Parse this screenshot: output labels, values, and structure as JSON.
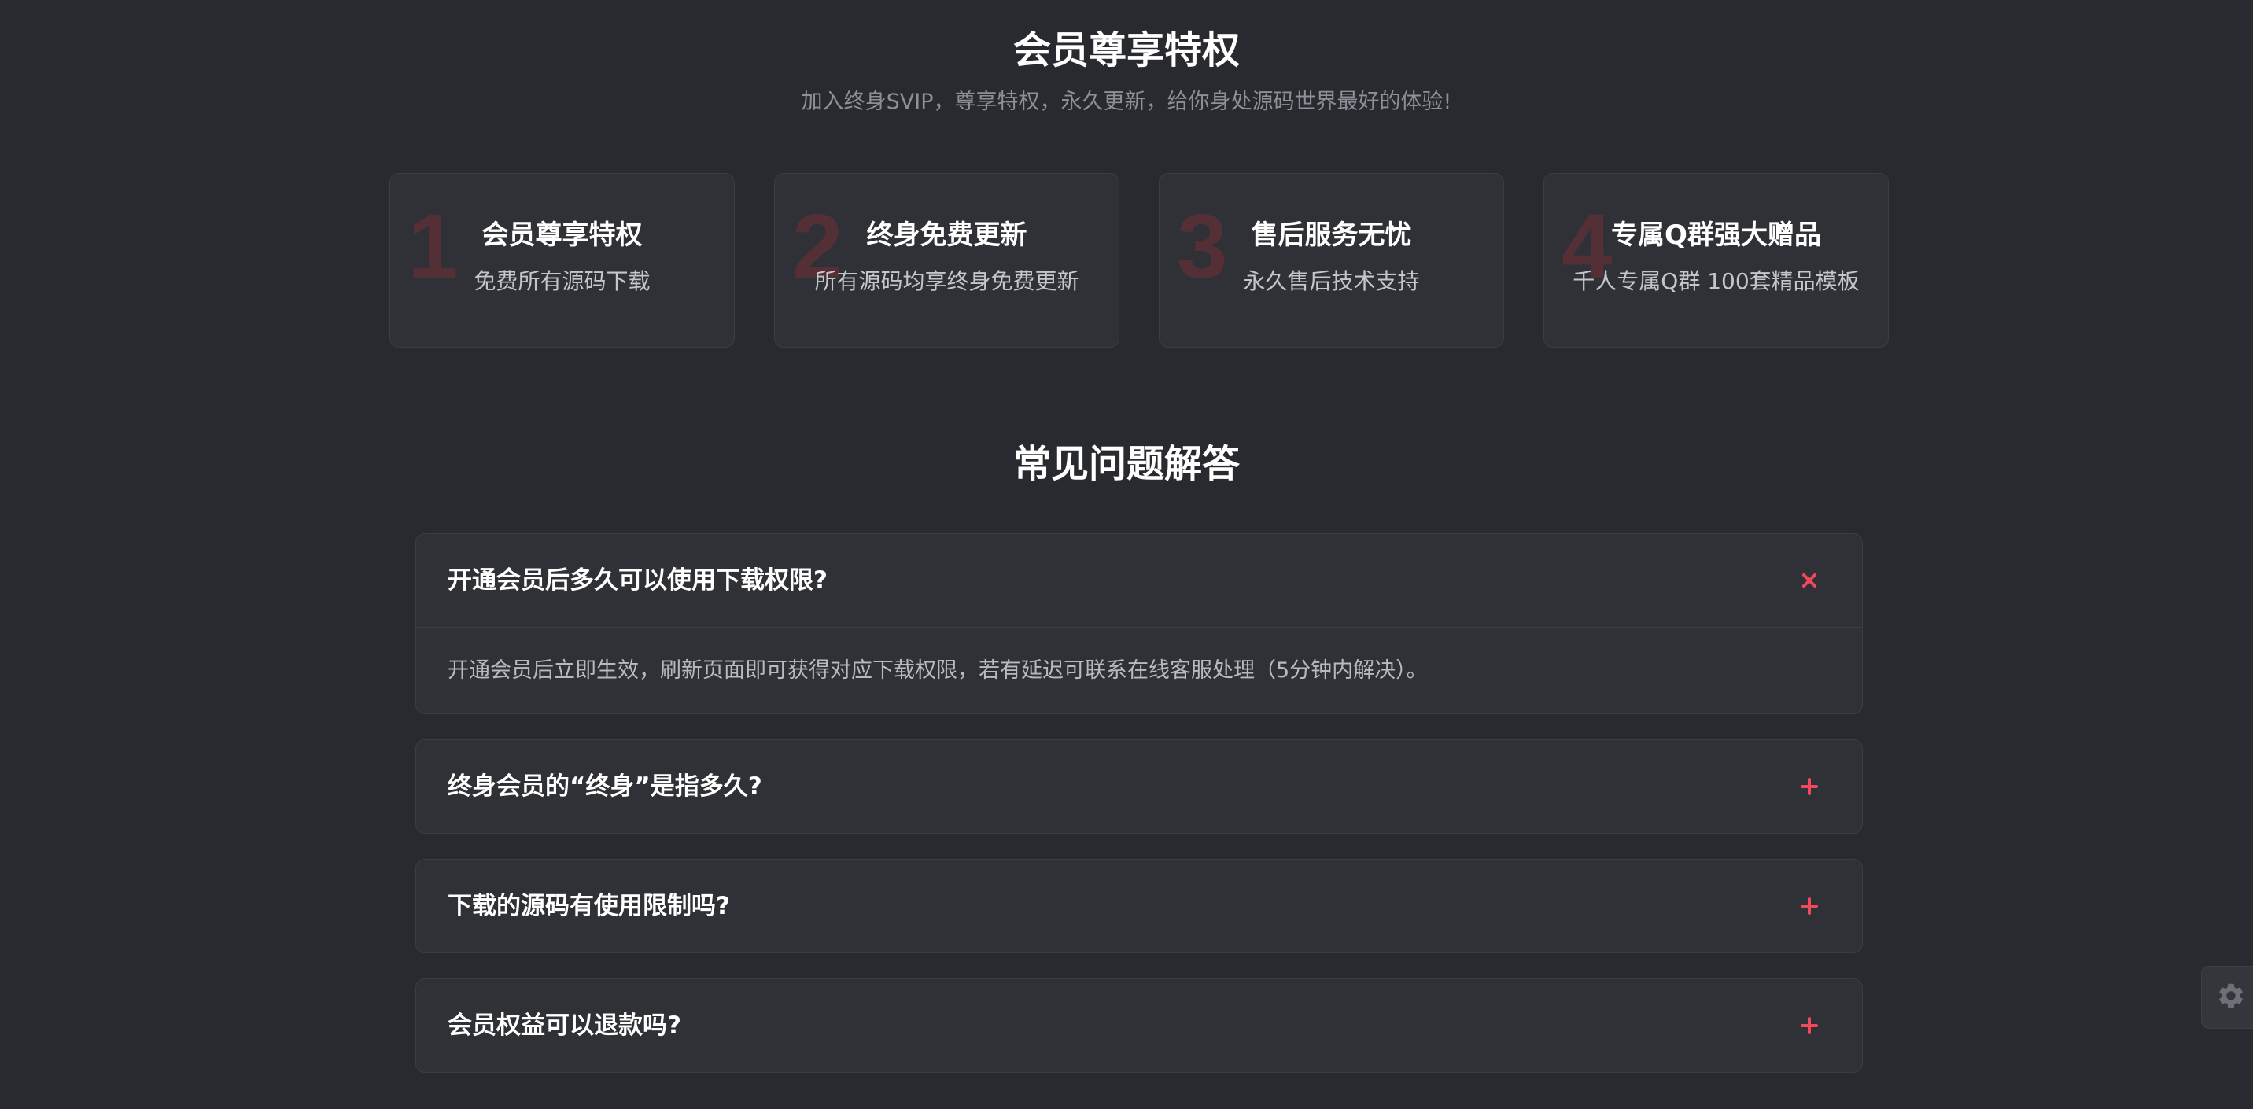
{
  "privileges": {
    "title": "会员尊享特权",
    "subtitle": "加入终身SVIP，尊享特权，永久更新，给你身处源码世界最好的体验!",
    "cards": [
      {
        "number": "1",
        "title": "会员尊享特权",
        "description": "免费所有源码下载"
      },
      {
        "number": "2",
        "title": "终身免费更新",
        "description": "所有源码均享终身免费更新"
      },
      {
        "number": "3",
        "title": "售后服务无忧",
        "description": "永久售后技术支持"
      },
      {
        "number": "4",
        "title": "专属Q群强大赠品",
        "description": "千人专属Q群 100套精品模板"
      }
    ]
  },
  "faq": {
    "title": "常见问题解答",
    "items": [
      {
        "question": "开通会员后多久可以使用下载权限?",
        "answer": "开通会员后立即生效，刷新页面即可获得对应下载权限，若有延迟可联系在线客服处理（5分钟内解决）。",
        "expanded": true,
        "toggle_icon": "close-icon"
      },
      {
        "question": "终身会员的“终身”是指多久?",
        "expanded": false,
        "toggle_icon": "plus-icon"
      },
      {
        "question": "下载的源码有使用限制吗?",
        "expanded": false,
        "toggle_icon": "plus-icon"
      },
      {
        "question": "会员权益可以退款吗?",
        "expanded": false,
        "toggle_icon": "plus-icon"
      }
    ]
  },
  "settings_button": {
    "icon": "gear-icon"
  },
  "colors": {
    "background": "#282a30",
    "card_background": "#2f3136",
    "accent": "#f0485c",
    "number_watermark": "#5b2f37"
  }
}
